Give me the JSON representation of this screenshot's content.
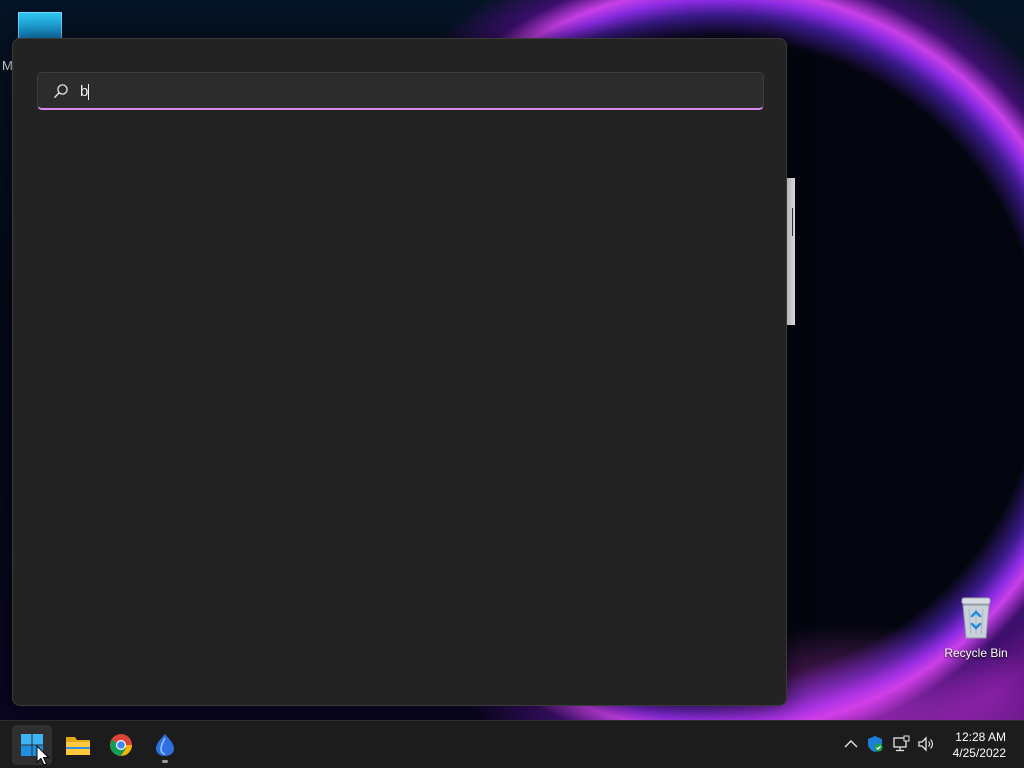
{
  "desktop": {
    "partial_letter": "M",
    "recycle_bin_label": "Recycle Bin"
  },
  "search": {
    "value": "b",
    "placeholder": ""
  },
  "taskbar": {
    "apps": [
      {
        "name": "start",
        "icon": "windows-logo-icon"
      },
      {
        "name": "file-explorer",
        "icon": "folder-icon"
      },
      {
        "name": "chrome",
        "icon": "chrome-icon"
      },
      {
        "name": "app",
        "icon": "app-icon"
      }
    ],
    "tray": {
      "icons": [
        "chevron-up-icon",
        "security-shield-icon",
        "network-icon",
        "volume-icon"
      ]
    },
    "clock": {
      "time": "12:28 AM",
      "date": "4/25/2022"
    }
  },
  "colors": {
    "accent": "#d88be8",
    "panel_bg": "#232323",
    "taskbar_bg": "#1c1c1c"
  }
}
